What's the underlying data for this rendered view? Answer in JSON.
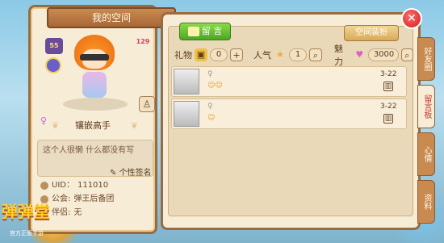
{
  "left": {
    "title": "我的空间",
    "level_badge": "55",
    "vip_badge": "129",
    "title_badge": "镶嵌高手",
    "signature": "这个人很懒 什么都没有写",
    "signature_btn": "个性签名",
    "uid_label": "UID：",
    "uid": "111010",
    "guild_label": "公会:",
    "guild": "弹王后备团",
    "partner_label": "伴侣:",
    "partner": "无"
  },
  "right": {
    "msg_btn": "留 言",
    "gift_btn": "空间装扮",
    "stats": {
      "gift_label": "礼物",
      "gift_val": "0",
      "pop_label": "人气",
      "pop_val": "1",
      "charm_label": "魅力",
      "charm_val": "3000"
    },
    "items": [
      {
        "date": "3-22"
      },
      {
        "date": "3-22"
      }
    ]
  },
  "tabs": [
    "好友圈",
    "留言板",
    "心情",
    "资料"
  ],
  "logo": {
    "text": "弹弹堂",
    "sub": "官方正版手游"
  },
  "close": "✕"
}
